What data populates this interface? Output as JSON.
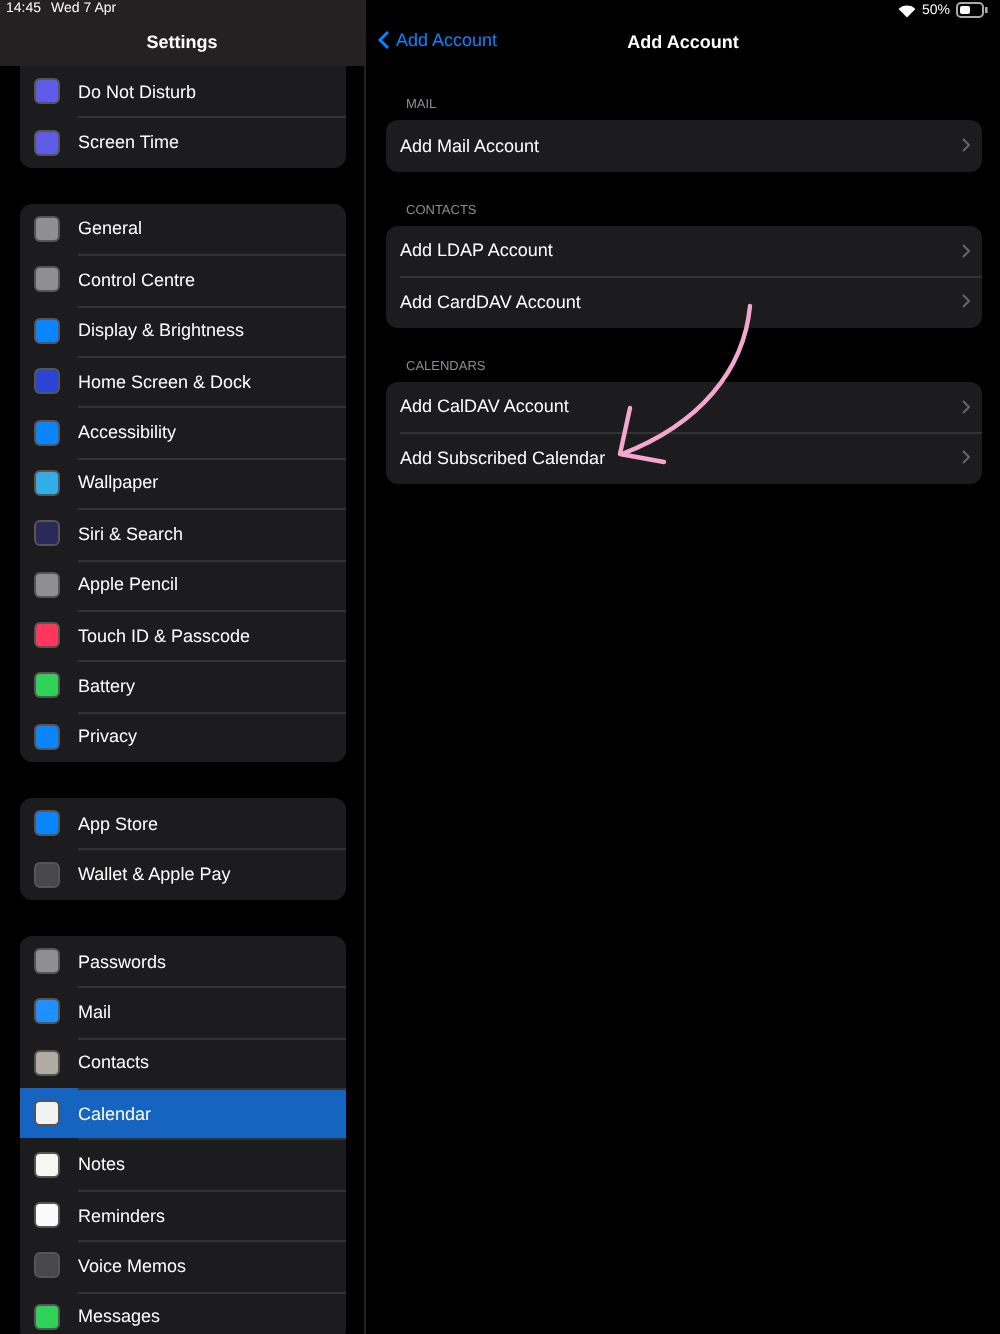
{
  "status_bar": {
    "time": "14:45",
    "date": "Wed 7 Apr",
    "battery": "50%"
  },
  "sidebar": {
    "title": "Settings",
    "groups": [
      {
        "items": [
          {
            "label": "Do Not Disturb",
            "color": "#5e5ce6",
            "selected": false
          },
          {
            "label": "Screen Time",
            "color": "#5e5ce6",
            "selected": false
          }
        ]
      },
      {
        "items": [
          {
            "label": "General",
            "color": "#8e8e93",
            "selected": false
          },
          {
            "label": "Control Centre",
            "color": "#8e8e93",
            "selected": false
          },
          {
            "label": "Display & Brightness",
            "color": "#0a84ff",
            "selected": false
          },
          {
            "label": "Home Screen & Dock",
            "color": "#2c44d6",
            "selected": false
          },
          {
            "label": "Accessibility",
            "color": "#0a84ff",
            "selected": false
          },
          {
            "label": "Wallpaper",
            "color": "#32ade6",
            "selected": false
          },
          {
            "label": "Siri & Search",
            "color": "#2a2a5a",
            "selected": false
          },
          {
            "label": "Apple Pencil",
            "color": "#8e8e93",
            "selected": false
          },
          {
            "label": "Touch ID & Passcode",
            "color": "#ff375f",
            "selected": false
          },
          {
            "label": "Battery",
            "color": "#30d158",
            "selected": false
          },
          {
            "label": "Privacy",
            "color": "#0a84ff",
            "selected": false
          }
        ]
      },
      {
        "items": [
          {
            "label": "App Store",
            "color": "#0a84ff",
            "selected": false
          },
          {
            "label": "Wallet & Apple Pay",
            "color": "#48484a",
            "selected": false
          }
        ]
      },
      {
        "items": [
          {
            "label": "Passwords",
            "color": "#8e8e93",
            "selected": false
          },
          {
            "label": "Mail",
            "color": "#1e90ff",
            "selected": false
          },
          {
            "label": "Contacts",
            "color": "#b0aca4",
            "selected": false
          },
          {
            "label": "Calendar",
            "color": "#f2f2f2",
            "selected": true
          },
          {
            "label": "Notes",
            "color": "#f7f7f2",
            "selected": false
          },
          {
            "label": "Reminders",
            "color": "#fafafa",
            "selected": false
          },
          {
            "label": "Voice Memos",
            "color": "#48484a",
            "selected": false
          },
          {
            "label": "Messages",
            "color": "#30d158",
            "selected": false
          }
        ]
      }
    ]
  },
  "detail": {
    "back": "Add Account",
    "title": "Add Account",
    "sections": [
      {
        "header": "MAIL",
        "rows": [
          "Add Mail Account"
        ]
      },
      {
        "header": "CONTACTS",
        "rows": [
          "Add LDAP Account",
          "Add CardDAV Account"
        ]
      },
      {
        "header": "CALENDARS",
        "rows": [
          "Add CalDAV Account",
          "Add Subscribed Calendar"
        ]
      }
    ]
  }
}
